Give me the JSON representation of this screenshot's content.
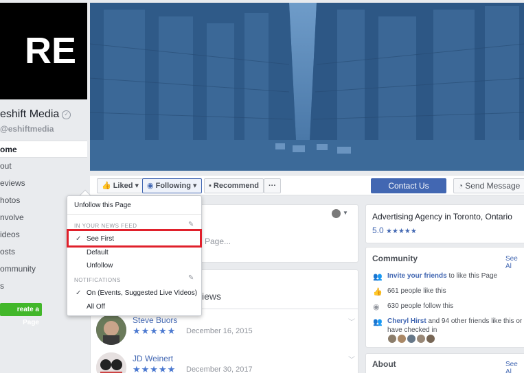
{
  "page": {
    "logo_text": "RE",
    "name": "eshift Media",
    "handle": "eshiftmedia",
    "verified_mark": "✓"
  },
  "nav": {
    "items": [
      {
        "label": "ome",
        "active": true
      },
      {
        "label": "out"
      },
      {
        "label": "eviews"
      },
      {
        "label": "hotos"
      },
      {
        "label": "nvolve"
      },
      {
        "label": "ideos"
      },
      {
        "label": "osts"
      },
      {
        "label": "ommunity"
      },
      {
        "label": "s"
      }
    ],
    "create_button": "reate a Page"
  },
  "action_bar": {
    "liked": "Liked",
    "following": "Following",
    "recommend": "Recommend",
    "more": "···",
    "contact": "Contact Us",
    "send_message": "Send Message"
  },
  "post": {
    "placeholder": "Page..."
  },
  "reviews": {
    "title": "views",
    "items": [
      {
        "name": "Steve Buors",
        "stars": "★★★★★",
        "date": "December 16, 2015"
      },
      {
        "name": "JD Weinert",
        "stars": "★★★★★",
        "date": "December 30, 2017"
      }
    ]
  },
  "about_card": {
    "category": "Advertising Agency in Toronto, Ontario",
    "rating": "5.0",
    "stars": "★★★★★"
  },
  "community": {
    "title": "Community",
    "see_all": "See Al",
    "invite_link": "Invite your friends",
    "invite_rest": "to like this Page",
    "likes": "661 people like this",
    "follows": "630 people follow this",
    "friend_name": "Cheryl Hirst",
    "friend_rest": "and 94 other friends like this or",
    "friend_rest2": "have checked in"
  },
  "about": {
    "title": "About",
    "see_all": "See Al"
  },
  "menu": {
    "unfollow_page": "Unfollow this Page",
    "news_feed_header": "IN YOUR NEWS FEED",
    "see_first": "See First",
    "default": "Default",
    "unfollow": "Unfollow",
    "notifications_header": "NOTIFICATIONS",
    "on_option": "On (Events, Suggested Live Videos)",
    "all_off": "All Off",
    "check": "✓",
    "highlight_color": "#e0202b"
  },
  "colors": {
    "brand_blue": "#4267b2",
    "cover_blue": "#3d6a99",
    "create_green": "#42b72a"
  }
}
